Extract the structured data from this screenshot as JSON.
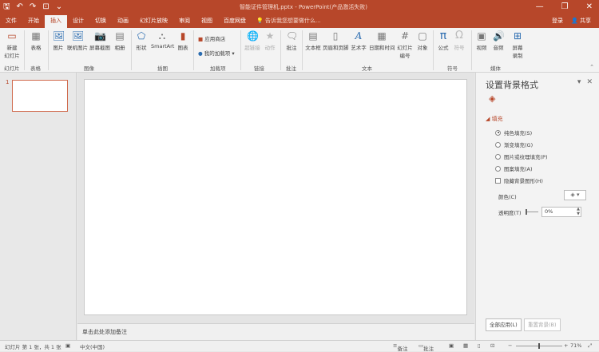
{
  "window": {
    "title": "智能证件管理机.pptx - PowerPoint(产品激活失败)",
    "minimize": "—",
    "restore": "❐",
    "close": "✕"
  },
  "qat": {
    "save": "🖫",
    "undo": "↶",
    "redo": "↷",
    "present": "⊡",
    "more": "⌄"
  },
  "tabs": [
    "文件",
    "开始",
    "插入",
    "设计",
    "切换",
    "动画",
    "幻灯片放映",
    "审阅",
    "视图",
    "百度网盘"
  ],
  "active_tab": "插入",
  "tellme": "告诉我您想要做什么...",
  "account": {
    "signin": "登录",
    "share": "共享"
  },
  "ribbon": {
    "new_slide": "新建\n幻灯片",
    "table": "表格",
    "picture": "图片",
    "online_picture": "联机图片",
    "screenshot": "屏幕截图",
    "album": "相册",
    "shapes": "形状",
    "smartart": "SmartArt",
    "chart": "图表",
    "store": "应用商店",
    "my_addins": "我的加载项",
    "hyperlink": "超链接",
    "action": "动作",
    "comment": "批注",
    "textbox": "文本框",
    "header_footer": "页眉和页脚",
    "wordart": "艺术字",
    "datetime": "日期和时间",
    "slide_number": "幻灯片\n编号",
    "object": "对象",
    "equation": "公式",
    "symbol": "符号",
    "video": "视频",
    "audio": "音频",
    "screen_record": "屏幕\n录制",
    "groups": {
      "slides": "幻灯片",
      "tables": "表格",
      "images": "图像",
      "illustrations": "插图",
      "addins": "加载项",
      "links": "链接",
      "comments": "批注",
      "text": "文本",
      "symbols": "符号",
      "media": "媒体"
    }
  },
  "thumbnails": {
    "slide_number": "1"
  },
  "notes_placeholder": "单击此处添加备注",
  "format_pane": {
    "title": "设置背景格式",
    "section": "◢ 填充",
    "options": [
      "纯色填充(S)",
      "渐变填充(G)",
      "图片或纹理填充(P)",
      "图案填充(A)"
    ],
    "selected_option": 0,
    "hide_graphics": "隐藏背景图形(H)",
    "color_label": "颜色(C)",
    "transparency_label": "透明度(T)",
    "transparency_value": "0%",
    "apply_all": "全部应用(L)",
    "reset": "重置背景(B)"
  },
  "status": {
    "slide_info": "幻灯片 第 1 张，共 1 张",
    "language": "中文(中国)",
    "notes": "备注",
    "comments": "批注",
    "zoom": "71%"
  },
  "colors": {
    "accent": "#b7472a"
  }
}
